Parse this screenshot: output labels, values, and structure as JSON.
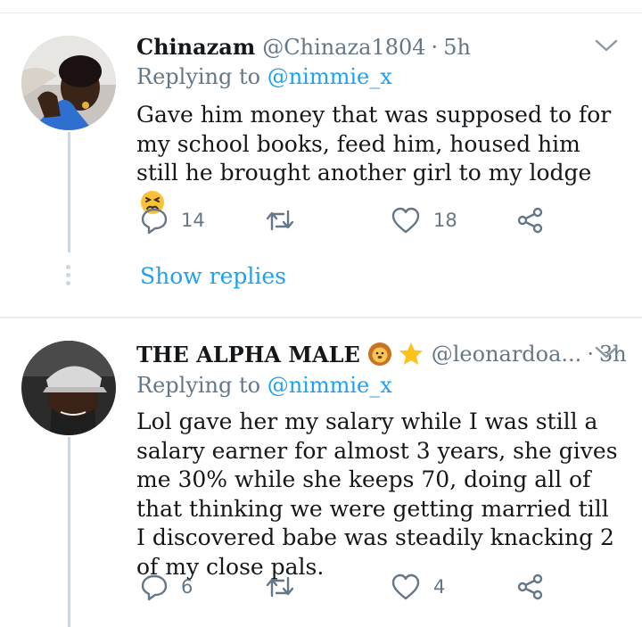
{
  "tweets": [
    {
      "name": "Chinazam",
      "handle": "@Chinaza1804",
      "time": "5h",
      "replying_prefix": "Replying to ",
      "replying_to": "@nimmie_x",
      "text": "Gave him money that was supposed to for my school books, feed him, housed him still he brought another girl to my lodge",
      "text_emoji": "persevering-face-emoji",
      "replies": "14",
      "retweets": "",
      "likes": "18"
    },
    {
      "name": "THE ALPHA MALE",
      "name_emojis": [
        "lion-face-emoji",
        "star-emoji"
      ],
      "handle": "@leonardoa...",
      "time": "3h",
      "replying_prefix": "Replying to ",
      "replying_to": "@nimmie_x",
      "text": "Lol gave her my salary while I was still a salary earner for almost 3 years, she gives me 30% while she keeps 70, doing all of that thinking we were getting married till I discovered babe was steadily knacking 2 of my close pals.",
      "replies": "6",
      "retweets": "",
      "likes": "4"
    }
  ],
  "show_replies": "Show replies",
  "colors": {
    "accent": "#1da1f2",
    "muted": "#657786",
    "text": "#14171a",
    "line": "#cdd7df"
  }
}
